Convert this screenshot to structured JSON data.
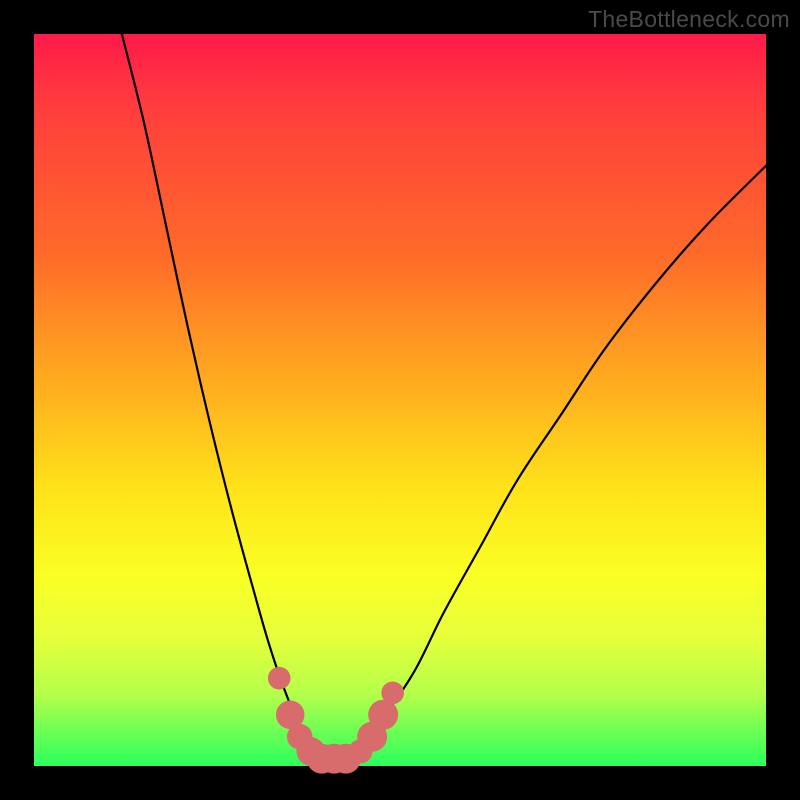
{
  "attribution": "TheBottleneck.com",
  "colors": {
    "frame": "#000000",
    "gradient_top": "#ff1a4a",
    "gradient_bottom": "#2bff5d",
    "curve": "#000000",
    "marker": "#d86b6b"
  },
  "chart_data": {
    "type": "line",
    "title": "",
    "xlabel": "",
    "ylabel": "",
    "xlim": [
      0,
      100
    ],
    "ylim": [
      0,
      100
    ],
    "series": [
      {
        "name": "bottleneck-curve",
        "x": [
          12,
          15,
          18,
          21,
          24,
          27,
          30,
          32,
          34,
          36,
          37.5,
          39,
          40.5,
          42,
          43.5,
          45,
          48,
          52,
          56,
          61,
          66,
          72,
          78,
          85,
          92,
          100
        ],
        "y": [
          100,
          88,
          74,
          60,
          47,
          35,
          24,
          17,
          11,
          6,
          3,
          1.5,
          1,
          1,
          1.5,
          3,
          7,
          13,
          21,
          30,
          39,
          48,
          57,
          66,
          74,
          82
        ]
      }
    ],
    "markers": {
      "name": "highlight-points",
      "points": [
        {
          "x": 33.5,
          "y": 12,
          "r": 1.0
        },
        {
          "x": 35.0,
          "y": 7,
          "r": 1.4
        },
        {
          "x": 36.3,
          "y": 4,
          "r": 1.2
        },
        {
          "x": 37.8,
          "y": 2,
          "r": 1.4
        },
        {
          "x": 39.3,
          "y": 1,
          "r": 1.5
        },
        {
          "x": 41.0,
          "y": 1,
          "r": 1.5
        },
        {
          "x": 42.6,
          "y": 1,
          "r": 1.5
        },
        {
          "x": 44.6,
          "y": 2,
          "r": 1.1
        },
        {
          "x": 46.2,
          "y": 4,
          "r": 1.5
        },
        {
          "x": 47.7,
          "y": 7,
          "r": 1.5
        },
        {
          "x": 49.0,
          "y": 10,
          "r": 1.0
        }
      ]
    }
  }
}
